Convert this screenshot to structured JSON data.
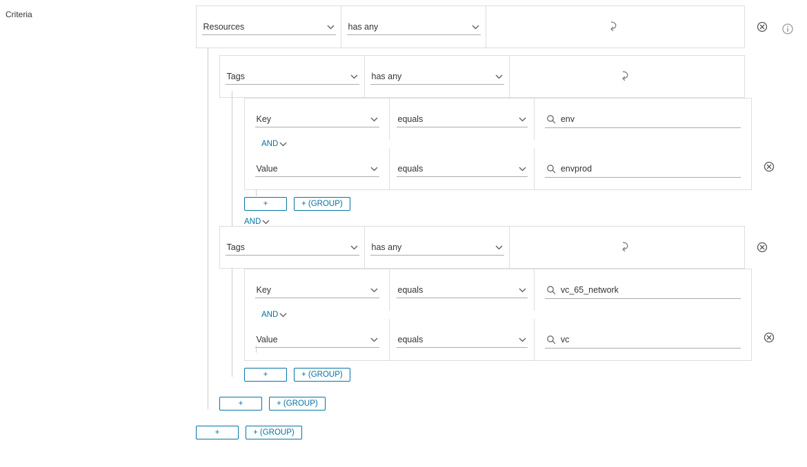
{
  "label": "Criteria",
  "buttons": {
    "plus": "+",
    "plus_group": "+ (GROUP)"
  },
  "connector": "AND",
  "resources": {
    "prop": "Resources",
    "op": "has any"
  },
  "tag_groups": [
    {
      "prop": "Tags",
      "op": "has any",
      "pairs": [
        {
          "prop": "Key",
          "op": "equals",
          "value": "env"
        },
        {
          "prop": "Value",
          "op": "equals",
          "value": "envprod"
        }
      ]
    },
    {
      "prop": "Tags",
      "op": "has any",
      "pairs": [
        {
          "prop": "Key",
          "op": "equals",
          "value": "vc_65_network"
        },
        {
          "prop": "Value",
          "op": "equals",
          "value": "vc"
        }
      ]
    }
  ]
}
